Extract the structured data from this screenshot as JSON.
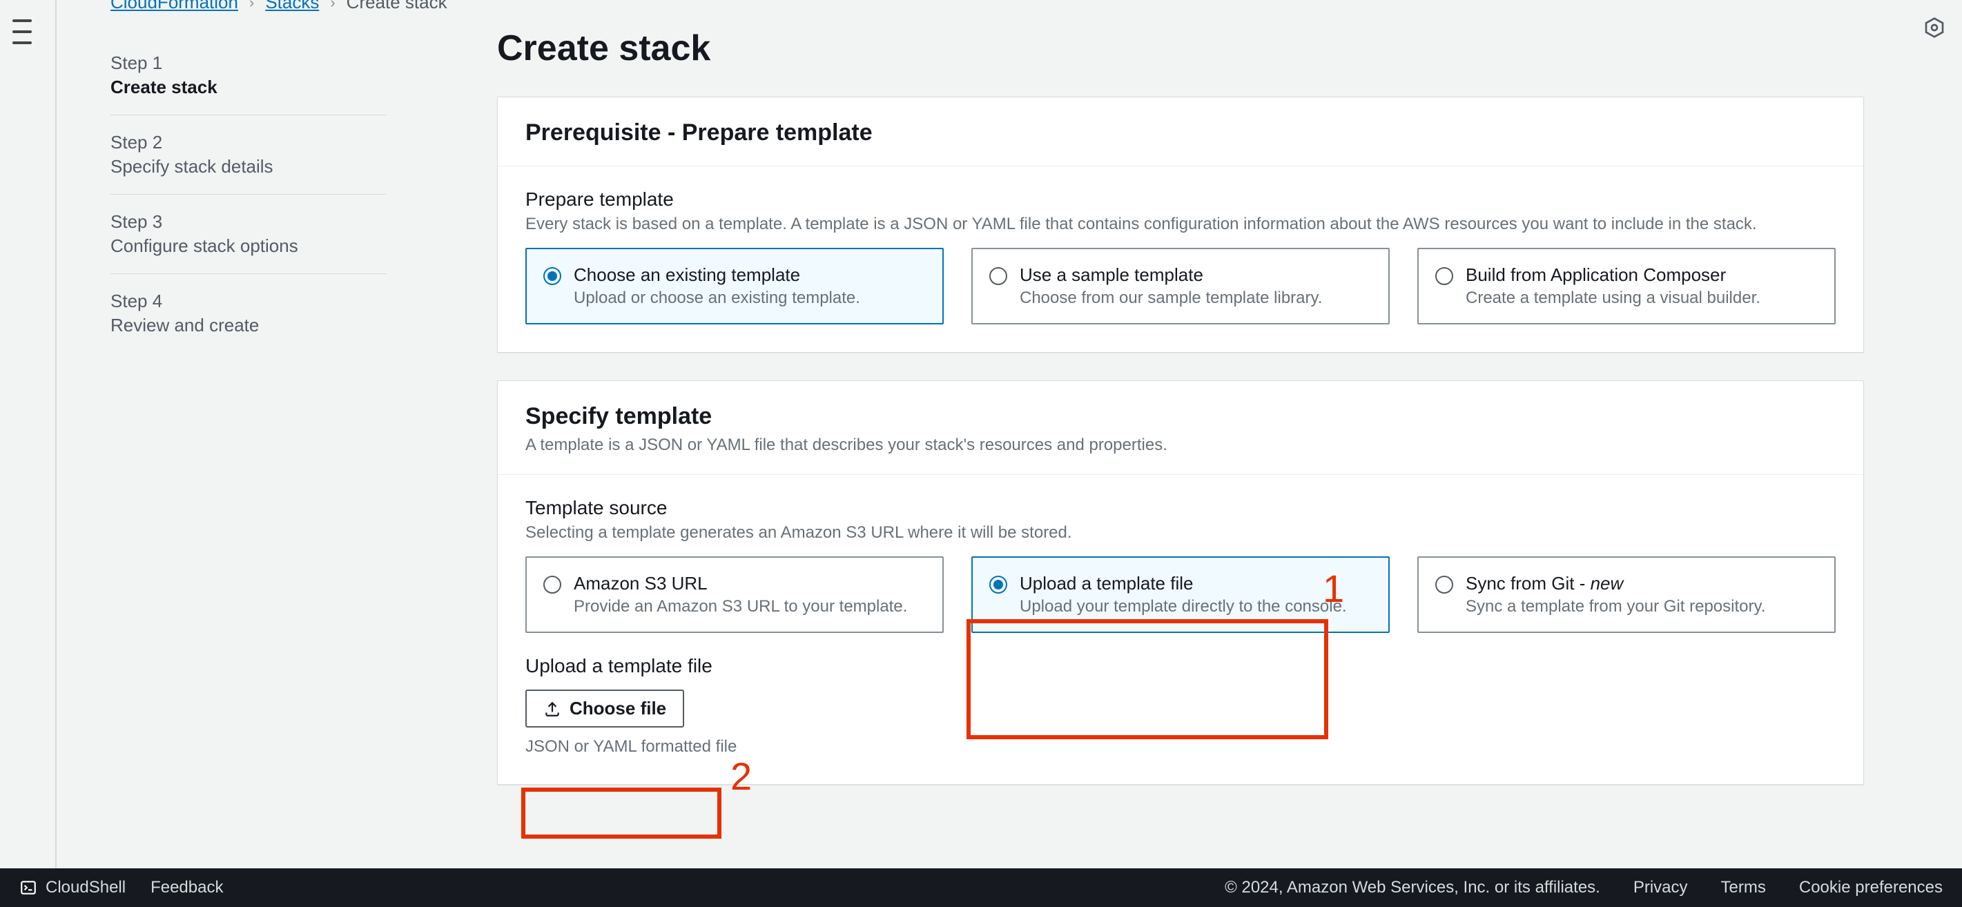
{
  "breadcrumbs": {
    "items": [
      "CloudFormation",
      "Stacks",
      "Create stack"
    ]
  },
  "page_title": "Create stack",
  "steps": [
    {
      "num": "Step 1",
      "title": "Create stack"
    },
    {
      "num": "Step 2",
      "title": "Specify stack details"
    },
    {
      "num": "Step 3",
      "title": "Configure stack options"
    },
    {
      "num": "Step 4",
      "title": "Review and create"
    }
  ],
  "prereq": {
    "heading": "Prerequisite - Prepare template",
    "section_title": "Prepare template",
    "section_desc": "Every stack is based on a template. A template is a JSON or YAML file that contains configuration information about the AWS resources you want to include in the stack.",
    "options": [
      {
        "title": "Choose an existing template",
        "desc": "Upload or choose an existing template."
      },
      {
        "title": "Use a sample template",
        "desc": "Choose from our sample template library."
      },
      {
        "title": "Build from Application Composer",
        "desc": "Create a template using a visual builder."
      }
    ]
  },
  "specify": {
    "heading": "Specify template",
    "heading_desc": "A template is a JSON or YAML file that describes your stack's resources and properties.",
    "section_title": "Template source",
    "section_desc": "Selecting a template generates an Amazon S3 URL where it will be stored.",
    "options": [
      {
        "title": "Amazon S3 URL",
        "desc": "Provide an Amazon S3 URL to your template."
      },
      {
        "title": "Upload a template file",
        "desc": "Upload your template directly to the console."
      },
      {
        "title_pre": "Sync from Git - ",
        "title_new": "new",
        "desc": "Sync a template from your Git repository."
      }
    ],
    "upload_label": "Upload a template file",
    "choose_file": "Choose file",
    "hint": "JSON or YAML formatted file"
  },
  "footer": {
    "cloudshell": "CloudShell",
    "feedback": "Feedback",
    "copyright": "© 2024, Amazon Web Services, Inc. or its affiliates.",
    "privacy": "Privacy",
    "terms": "Terms",
    "cookies": "Cookie preferences"
  },
  "annotations": {
    "one": "1",
    "two": "2"
  }
}
